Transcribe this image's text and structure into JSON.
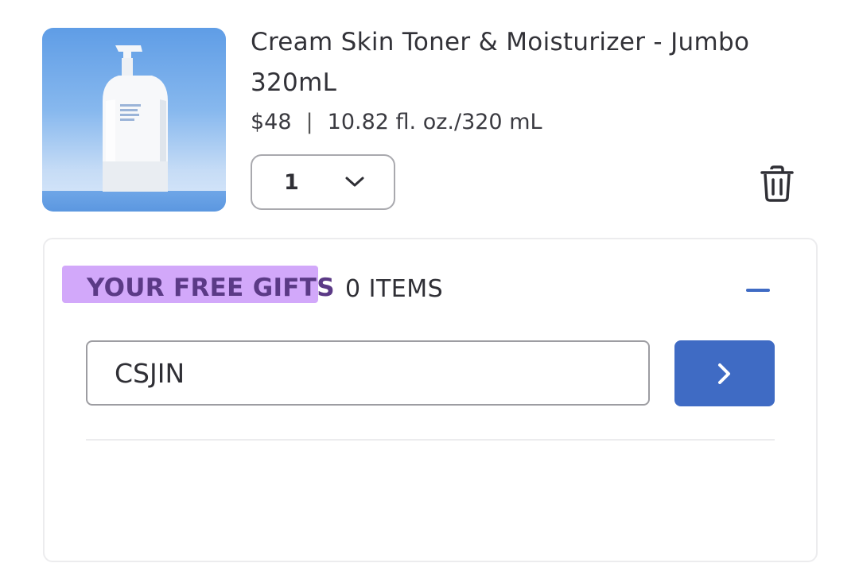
{
  "product": {
    "title": "Cream Skin Toner & Moisturizer - Jumbo 320mL",
    "price": "$48",
    "separator": "|",
    "size": "10.82 fl. oz./320 mL",
    "quantity": "1",
    "image_icon": "toner-bottle-image",
    "delete_icon": "trash-icon"
  },
  "free_gifts": {
    "title": "YOUR FREE GIFTS",
    "count": "0 ITEMS",
    "toggle_icon": "minus-icon",
    "code_value": "CSJIN",
    "submit_icon": "chevron-right-icon"
  },
  "colors": {
    "accent": "#3f6bc4",
    "highlight": "#d2a8fa",
    "gift_title": "#5b3a86"
  }
}
